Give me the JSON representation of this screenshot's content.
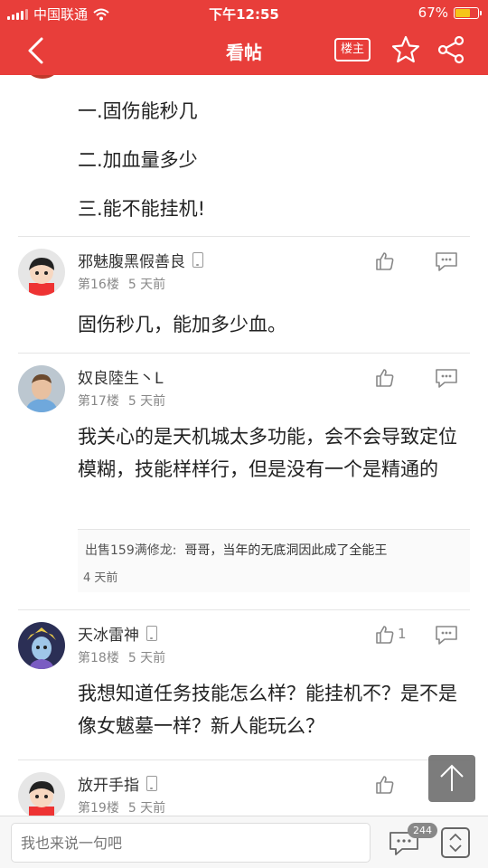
{
  "status_bar": {
    "carrier": "中国联通",
    "time": "下午12:55",
    "battery": "67%",
    "battery_level": 0.67
  },
  "nav": {
    "title": "看帖",
    "host_only_label": "楼主"
  },
  "op_lines": [
    "一.固伤能秒几",
    "二.加血量多少",
    "三.能不能挂机!"
  ],
  "posts": [
    {
      "username": "邪魅腹黑假善良",
      "floor": "第16楼",
      "time": "5 天前",
      "text": "固伤秒几，能加多少血。"
    },
    {
      "username": "奴良陸生丶L",
      "floor": "第17楼",
      "time": "5 天前",
      "text": "我关心的是天机城太多功能，会不会导致定位模糊，技能样样行，但是没有一个是精通的",
      "reply": {
        "name": "出售159满修龙:",
        "text": "哥哥，当年的无底洞因此成了全能王",
        "time": "4 天前"
      }
    },
    {
      "username": "天冰雷神",
      "floor": "第18楼",
      "time": "5 天前",
      "likes": "1",
      "text": "我想知道任务技能怎么样？能挂机不？是不是像女魃墓一样？新人能玩么？"
    },
    {
      "username": "放开手指",
      "floor": "第19楼",
      "time": "5 天前"
    }
  ],
  "bottom_bar": {
    "placeholder": "我也来说一句吧",
    "comment_count": "244"
  },
  "colors": {
    "brand_red": "#e83e3a"
  }
}
